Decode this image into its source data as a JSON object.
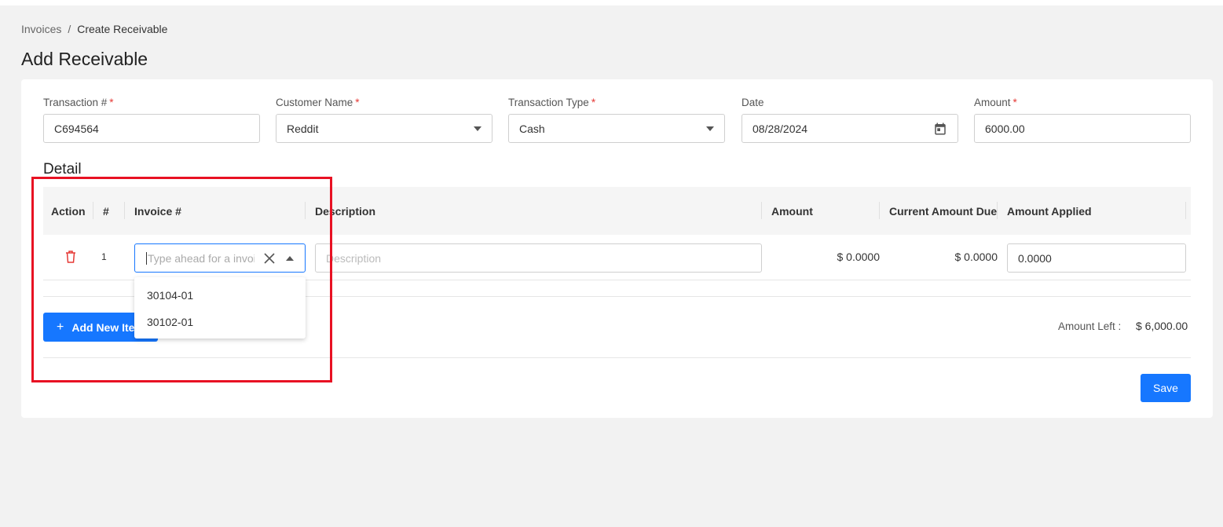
{
  "breadcrumb": {
    "parent": "Invoices",
    "separator": "/",
    "current": "Create Receivable"
  },
  "page_title": "Add Receivable",
  "form": {
    "transaction": {
      "label": "Transaction #",
      "required_mark": "*",
      "value": "C694564"
    },
    "customer": {
      "label": "Customer Name",
      "required_mark": "*",
      "value": "Reddit"
    },
    "type": {
      "label": "Transaction Type",
      "required_mark": "*",
      "value": "Cash"
    },
    "date": {
      "label": "Date",
      "value": "08/28/2024"
    },
    "amount": {
      "label": "Amount",
      "required_mark": "*",
      "value": "6000.00"
    }
  },
  "detail": {
    "title": "Detail",
    "columns": {
      "action": "Action",
      "num": "#",
      "invoice": "Invoice #",
      "description": "Description",
      "amount": "Amount",
      "current_due": "Current Amount Due",
      "applied": "Amount Applied"
    },
    "row": {
      "num": "1",
      "invoice_placeholder": "Type ahead for a invoice",
      "description_placeholder": "Description",
      "amount": "$ 0.0000",
      "current_due": "$ 0.0000",
      "applied": "0.0000"
    },
    "dropdown_options": [
      "30104-01",
      "30102-01"
    ],
    "add_button": "Add New Item",
    "amount_left_label": "Amount Left :",
    "amount_left_value": "$ 6,000.00"
  },
  "save_button": "Save",
  "icons": {
    "delete": "trash-icon",
    "calendar": "calendar-icon",
    "clear": "close-icon",
    "dropdown": "chevron-down-icon"
  },
  "colors": {
    "accent": "#1677ff",
    "required": "#e53935",
    "highlight": "#e81123",
    "delete": "#e53935"
  }
}
